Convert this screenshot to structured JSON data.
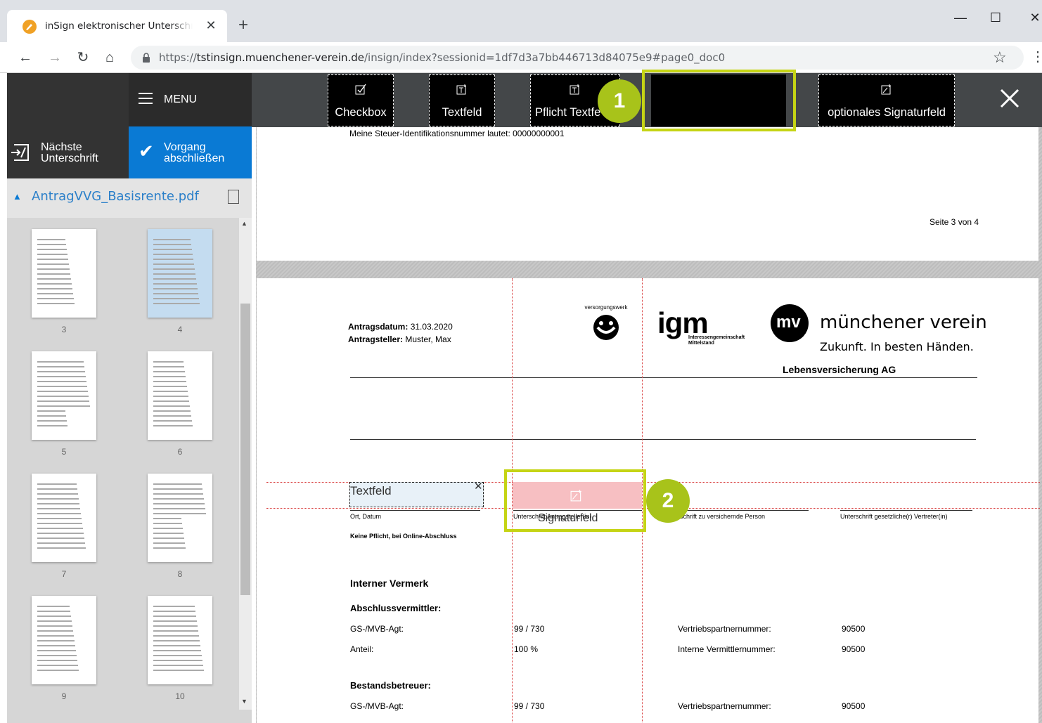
{
  "browser": {
    "tab_title": "inSign elektronischer Unterschrift",
    "url_scheme": "https://",
    "url_host": "tstinsign.muenchener-verein.de",
    "url_path": "/insign/index?sessionid=1df7d3a7bb446713d84075e9#page0_doc0"
  },
  "sidebar": {
    "menu_label": "MENU",
    "next_signature_line1": "Nächste",
    "next_signature_line2": "Unterschrift",
    "finish_line1": "Vorgang",
    "finish_line2": "abschließen",
    "document_name": "AntragVVG_Basisrente.pdf",
    "thumbnails": [
      {
        "label": "3",
        "active": false
      },
      {
        "label": "4",
        "active": true
      },
      {
        "label": "5",
        "active": false
      },
      {
        "label": "6",
        "active": false
      },
      {
        "label": "7",
        "active": false
      },
      {
        "label": "8",
        "active": false
      },
      {
        "label": "9",
        "active": false
      },
      {
        "label": "10",
        "active": false
      }
    ]
  },
  "field_toolbar": {
    "checkbox": "Checkbox",
    "textfield": "Textfeld",
    "required_textfield": "Pflicht Textfe",
    "optional_signature": "optionales Signaturfeld"
  },
  "page3": {
    "tax_line": "Meine Steuer-Identifikationsnummer lautet: 00000000001",
    "page_number": "Seite 3 von 4"
  },
  "page4": {
    "date_label": "Antragsdatum:",
    "date_value": "31.03.2020",
    "applicant_label": "Antragsteller:",
    "applicant_value": "Muster, Max",
    "logo_vw": "versorgungswerk",
    "logo_igm": "igm",
    "logo_igm_sub1": "Interessengemeinschaft",
    "logo_igm_sub2": "Mittelstand",
    "logo_mv": "mv",
    "logo_mv_name": "münchener verein",
    "logo_mv_slogan": "Zukunft. In besten Händen.",
    "logo_mv_company": "Lebensversicherung AG",
    "textfield_value": "Textfeld",
    "signature_field_label": "Signaturfeld",
    "sig_label_place_date": "Ort, Datum",
    "sig_label_applicant": "Unterschrift Antragsteller(in)",
    "sig_label_insured": "Unterschrift zu versichernde Person",
    "sig_label_representative": "Unterschrift gesetzliche(r) Vertreter(in)",
    "no_obligation": "Keine Pflicht, bei Online-Abschluss",
    "internal_note": "Interner Vermerk",
    "agent_heading": "Abschlussvermittler:",
    "row1_label": "GS-/MVB-Agt:",
    "row1_value": "99 / 730",
    "row1_label2": "Vertriebspartnernummer:",
    "row1_value2": "90500",
    "row2_label": "Anteil:",
    "row2_value": "100 %",
    "row2_label2": "Interne Vermittlernummer:",
    "row2_value2": "90500",
    "custodian_heading": "Bestandsbetreuer:",
    "row3_label": "GS-/MVB-Agt:",
    "row3_value": "99 / 730",
    "row3_label2": "Vertriebspartnernummer:",
    "row3_value2": "90500"
  },
  "callouts": {
    "one": "1",
    "two": "2"
  },
  "colors": {
    "accent_blue": "#0a7ad4",
    "callout_green": "#a8c31a",
    "signature_field_pink": "#f7bfc2",
    "textfield_bg": "#e8f1f8"
  }
}
